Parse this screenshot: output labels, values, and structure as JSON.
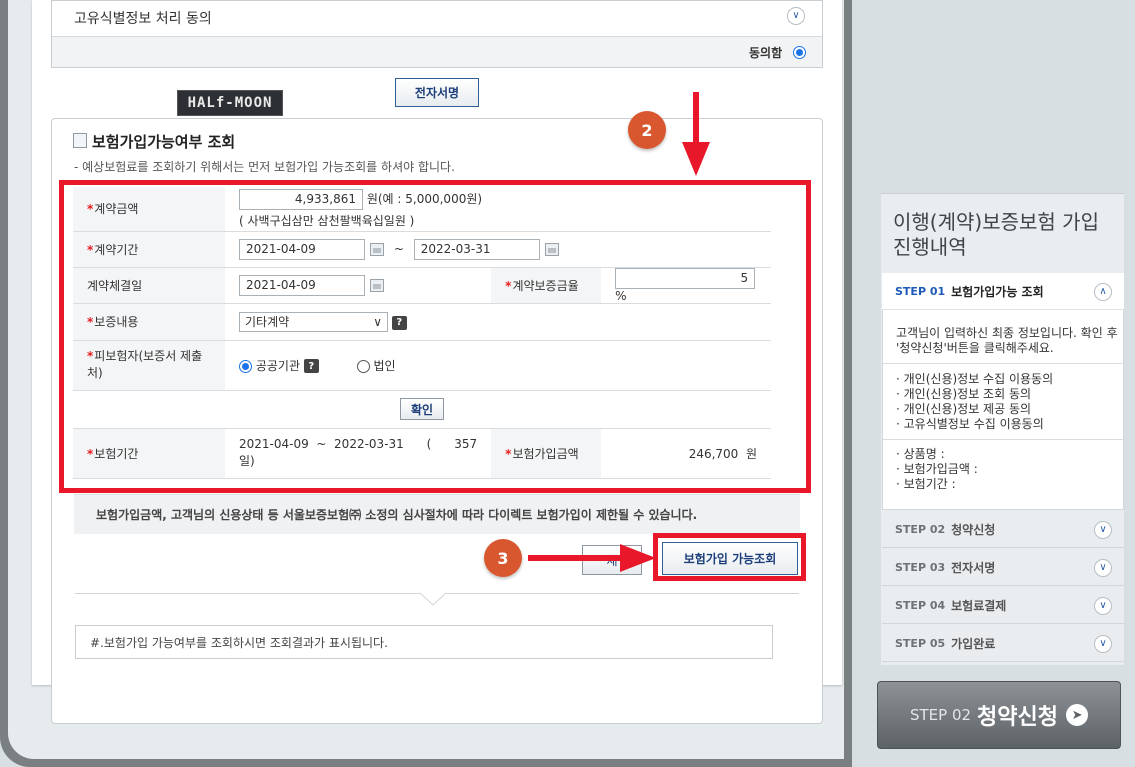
{
  "agreement": {
    "title": "고유식별정보 처리 동의",
    "agreed_label": "동의함"
  },
  "sign_button": "전자서명",
  "logo_text": "HALf-MOON",
  "inquiry": {
    "title": "보험가입가능여부 조회",
    "note": "- 예상보험료를 조회하기 위해서는 먼저 보험가입 가능조회를 하셔야 합니다.",
    "required_mark": "*",
    "fields": {
      "contract_amount_label": "계약금액",
      "contract_amount_value": "4,933,861",
      "contract_amount_unit": "원(예 : 5,000,000원)",
      "contract_amount_korean": "( 사백구십삼만 삼천팔백육십일원 )",
      "contract_period_label": "계약기간",
      "contract_start": "2021-04-09",
      "tilde": "~",
      "contract_end": "2022-03-31",
      "contract_date_label": "계약체결일",
      "contract_date": "2021-04-09",
      "guarantee_rate_label": "계약보증금율",
      "guarantee_rate": "5",
      "percent": "%",
      "guarantee_content_label": "보증내용",
      "guarantee_content_value": "기타계약",
      "insured_label": "피보험자(보증서 제출처)",
      "insured_opt1": "공공기관",
      "insured_opt2": "법인",
      "confirm_button": "확인",
      "period_label": "보험기간",
      "period_value_line1": "2021-04-09  ~  2022-03-31      (      357",
      "period_value_line2": "일)",
      "insured_amount_label": "보험가입금액",
      "insured_amount_value": "246,700",
      "won": "원"
    },
    "notice": "보험가입금액, 고객님의 신용상태 등 서울보증보험㈜ 소정의 심사절차에 따라 다이렉트 보험가입이 제한될 수 있습니다.",
    "hidden_button": "재",
    "check_button": "보험가입 가능조회",
    "result_note": "#.보험가입 가능여부를 조회하시면 조회결과가 표시됩니다."
  },
  "annotations": {
    "badge2": "2",
    "badge3": "3",
    "color": "#e8182a"
  },
  "sidebar": {
    "title": "이행(계약)보증보험 가입 진행내역",
    "steps": [
      {
        "no": "STEP 01",
        "name": "보험가입가능 조회"
      },
      {
        "no": "STEP 02",
        "name": "청약신청"
      },
      {
        "no": "STEP 03",
        "name": "전자서명"
      },
      {
        "no": "STEP 04",
        "name": "보험료결제"
      },
      {
        "no": "STEP 05",
        "name": "가입완료"
      }
    ],
    "step1_desc": "고객님이 입력하신 최종 정보입니다. 확인 후 '청약신청'버튼을 클릭해주세요.",
    "consents": [
      "개인(신용)정보 수집 이용동의",
      "개인(신용)정보 조회 동의",
      "개인(신용)정보 제공 동의",
      "고유식별정보 수집 이용동의"
    ],
    "summary": [
      "상품명 :",
      "보험가입금액 :",
      "보험기간 :"
    ],
    "big_button_step": "STEP 02",
    "big_button_label": "청약신청"
  }
}
